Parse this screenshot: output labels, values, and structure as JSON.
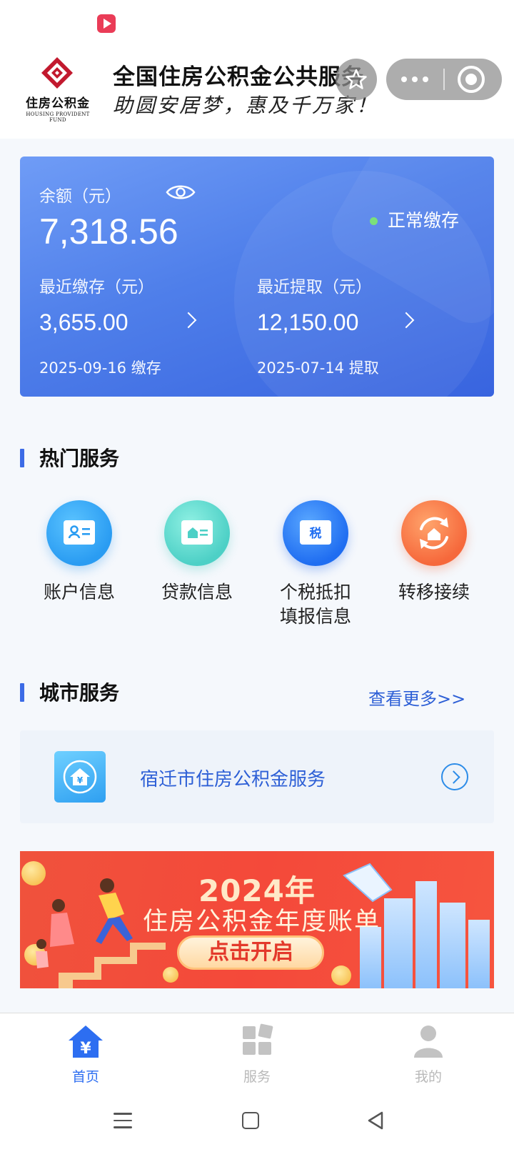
{
  "header": {
    "logo_text": "住房公积金",
    "logo_subtext": "HOUSING PROVIDENT FUND",
    "title": "全国住房公积金公共服务",
    "slogan": "助圆安居梦，惠及千万家！"
  },
  "balance": {
    "label": "余额（元）",
    "value": "7,318.56",
    "status": "正常缴存",
    "recent_deposit": {
      "label": "最近缴存（元）",
      "value": "3,655.00",
      "date": "2025-09-16 缴存"
    },
    "recent_withdraw": {
      "label": "最近提取（元）",
      "value": "12,150.00",
      "date": "2025-07-14 提取"
    }
  },
  "hot_services": {
    "title": "热门服务",
    "items": [
      {
        "label": "账户信息",
        "icon": "account-card-icon"
      },
      {
        "label": "贷款信息",
        "icon": "loan-card-icon"
      },
      {
        "label_line1": "个税抵扣",
        "label_line2": "填报信息",
        "icon": "tax-card-icon",
        "glyph": "税"
      },
      {
        "label": "转移接续",
        "icon": "transfer-icon"
      }
    ]
  },
  "city_services": {
    "title": "城市服务",
    "more": "查看更多>>",
    "item_label": "宿迁市住房公积金服务"
  },
  "banner": {
    "year": "2024年",
    "title": "住房公积金年度账单",
    "button": "点击开启"
  },
  "tabbar": {
    "home": "首页",
    "services": "服务",
    "mine": "我的"
  },
  "colors": {
    "accent": "#2d6ef1",
    "card_gradient_start": "#6f9cf6",
    "card_gradient_end": "#3864df",
    "banner_red": "#f4493a",
    "status_green": "#7be07b"
  }
}
